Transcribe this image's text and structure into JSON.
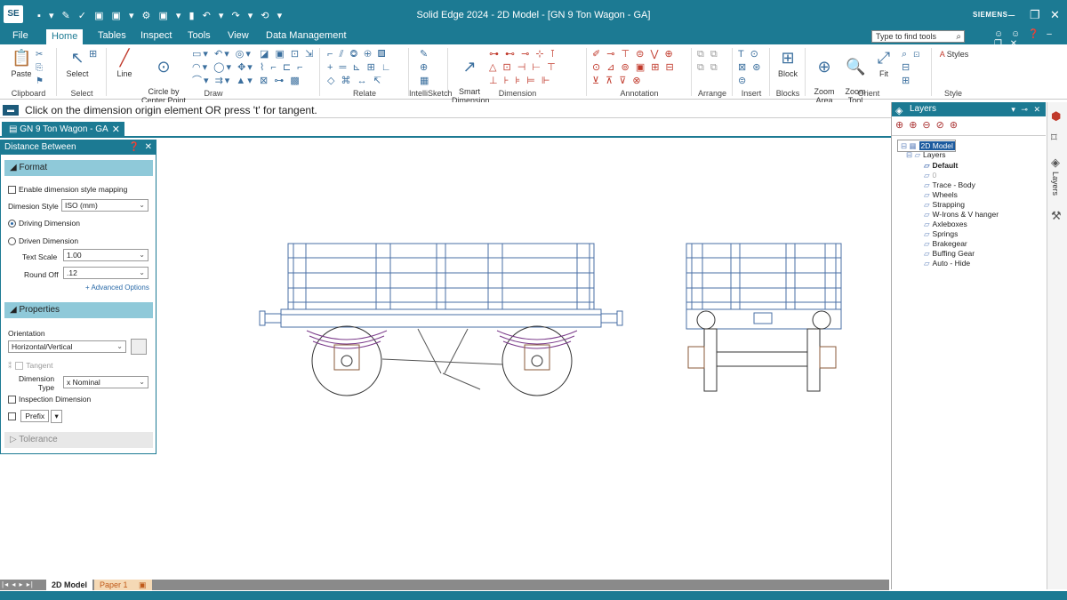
{
  "app": {
    "logo": "SE",
    "title": "Solid Edge 2024 - 2D Model - [GN 9 Ton Wagon - GA]",
    "brand": "SIEMENS",
    "quick_access": "▪ ▾ ✎ ✓ ▣ ▣ ▾ ⚙ ▣ ▾ ▮ ↶ ▾ ↷ ▾ ⟲ ▾"
  },
  "menu": {
    "items": [
      "File",
      "Home",
      "Tables",
      "Inspect",
      "Tools",
      "View",
      "Data Management"
    ],
    "active": "Home",
    "search_placeholder": "Type to find tools"
  },
  "ribbon": {
    "groups": {
      "clipboard": "Clipboard",
      "select": "Select",
      "draw": "Draw",
      "relate": "Relate",
      "intellisketch": "IntelliSketch",
      "dimension": "Dimension",
      "annotation": "Annotation",
      "arrange": "Arrange",
      "insert": "Insert",
      "blocks": "Blocks",
      "orient": "Orient",
      "style": "Style"
    },
    "buttons": {
      "paste": "Paste",
      "select": "Select",
      "line": "Line",
      "circle": "Circle by\nCenter Point",
      "smart_dimension": "Smart\nDimension",
      "block": "Block",
      "zoom_area": "Zoom\nArea",
      "zoom_tool": "Zoom\nTool",
      "fit": "Fit",
      "styles": "Styles"
    }
  },
  "prompt": "Click on the dimension origin element  OR press 't' for tangent.",
  "document_tab": "GN 9 Ton Wagon - GA",
  "command_panel": {
    "title": "Distance Between",
    "format_section": "Format",
    "enable_mapping": "Enable dimension style mapping",
    "dimension_style_label": "Dimesion Style",
    "dimension_style_value": "ISO (mm)",
    "driving": "Driving Dimension",
    "driven": "Driven Dimension",
    "text_scale_label": "Text Scale",
    "text_scale_value": "1.00",
    "round_off_label": "Round Off",
    "round_off_value": ".12",
    "advanced": "+ Advanced Options",
    "properties_section": "Properties",
    "orientation_label": "Orientation",
    "orientation_value": "Horizontal/Vertical",
    "tangent": "Tangent",
    "dimension_type_label": "Dimension\nType",
    "dimension_type_value": "x  Nominal",
    "inspection": "Inspection Dimension",
    "prefix": "Prefix",
    "tolerance_section": "Tolerance"
  },
  "layers_panel": {
    "title": "Layers",
    "root": "2D Model",
    "group": "Layers",
    "items": [
      "Default",
      "0",
      "Trace - Body",
      "Wheels",
      "Strapping",
      "W-Irons & V hanger",
      "Axleboxes",
      "Springs",
      "Brakegear",
      "Buffing Gear",
      "Auto - Hide"
    ],
    "side_label": "Layers"
  },
  "sheet_tabs": [
    "2D Model",
    "Paper 1"
  ],
  "colors": {
    "accent": "#1c7a93",
    "selection": "#1c5a9e",
    "drawing_line": "#4a6fa5"
  }
}
